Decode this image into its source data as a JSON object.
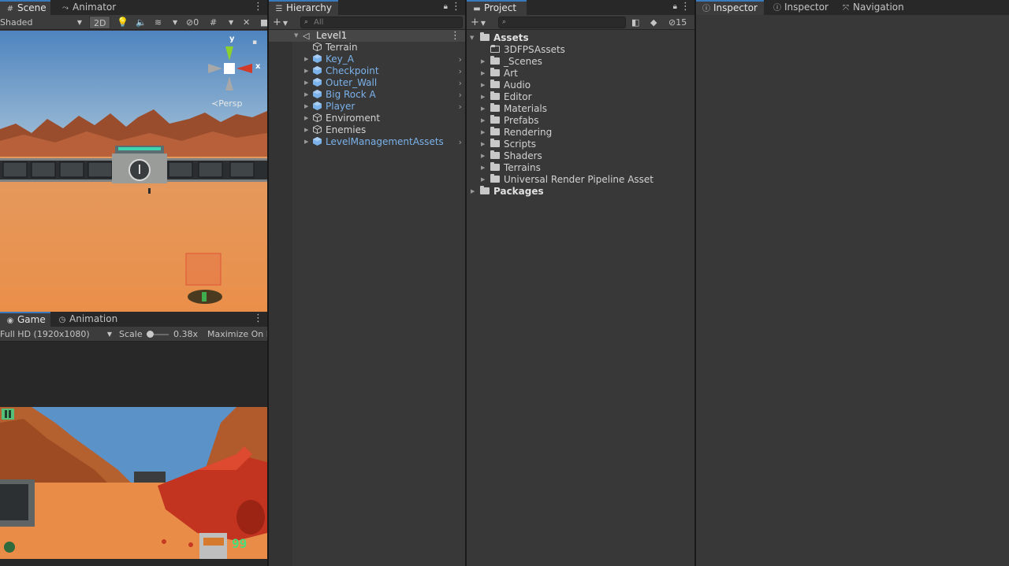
{
  "scene": {
    "tabs": [
      {
        "label": "Scene",
        "icon": "hash-icon"
      },
      {
        "label": "Animator",
        "icon": "animator-icon"
      }
    ],
    "toolbar": {
      "shading": "Shaded",
      "mode_2d": "2D",
      "hidden_count": "0"
    },
    "gizmo": {
      "y": "y",
      "x": "x",
      "persp": "Persp"
    }
  },
  "game": {
    "tabs": [
      {
        "label": "Game",
        "icon": "gamepad-icon"
      },
      {
        "label": "Animation",
        "icon": "clock-icon"
      }
    ],
    "toolbar": {
      "resolution": "Full HD (1920x1080)",
      "scale_label": "Scale",
      "scale_value": "0.38x",
      "maximize": "Maximize On P"
    },
    "hud": {
      "ammo": "99"
    }
  },
  "hierarchy": {
    "tab": "Hierarchy",
    "search_placeholder": "All",
    "scene_name": "Level1",
    "items": [
      {
        "label": "Terrain",
        "prefab": false,
        "expandable": false
      },
      {
        "label": "Key_A",
        "prefab": true,
        "expandable": true
      },
      {
        "label": "Checkpoint",
        "prefab": true,
        "expandable": true
      },
      {
        "label": "Outer_Wall",
        "prefab": true,
        "expandable": true
      },
      {
        "label": "Big Rock A",
        "prefab": true,
        "expandable": true
      },
      {
        "label": "Player",
        "prefab": true,
        "expandable": true
      },
      {
        "label": "Enviroment",
        "prefab": false,
        "expandable": true
      },
      {
        "label": "Enemies",
        "prefab": false,
        "expandable": true
      },
      {
        "label": "LevelManagementAssets",
        "prefab": true,
        "expandable": true
      }
    ]
  },
  "project": {
    "tab": "Project",
    "hidden_count": "15",
    "root": "Assets",
    "folders": [
      "3DFPSAssets",
      "_Scenes",
      "Art",
      "Audio",
      "Editor",
      "Materials",
      "Prefabs",
      "Rendering",
      "Scripts",
      "Shaders",
      "Terrains",
      "Universal Render Pipeline Asset"
    ],
    "packages": "Packages"
  },
  "inspector": {
    "tabs": [
      {
        "label": "Inspector",
        "icon": "info-icon"
      },
      {
        "label": "Inspector",
        "icon": "info-icon"
      },
      {
        "label": "Navigation",
        "icon": "navigation-icon"
      }
    ]
  },
  "colors": {
    "prefab": "#7bb2ea",
    "active_tab_accent": "#3a79bb",
    "panel": "#383838"
  }
}
